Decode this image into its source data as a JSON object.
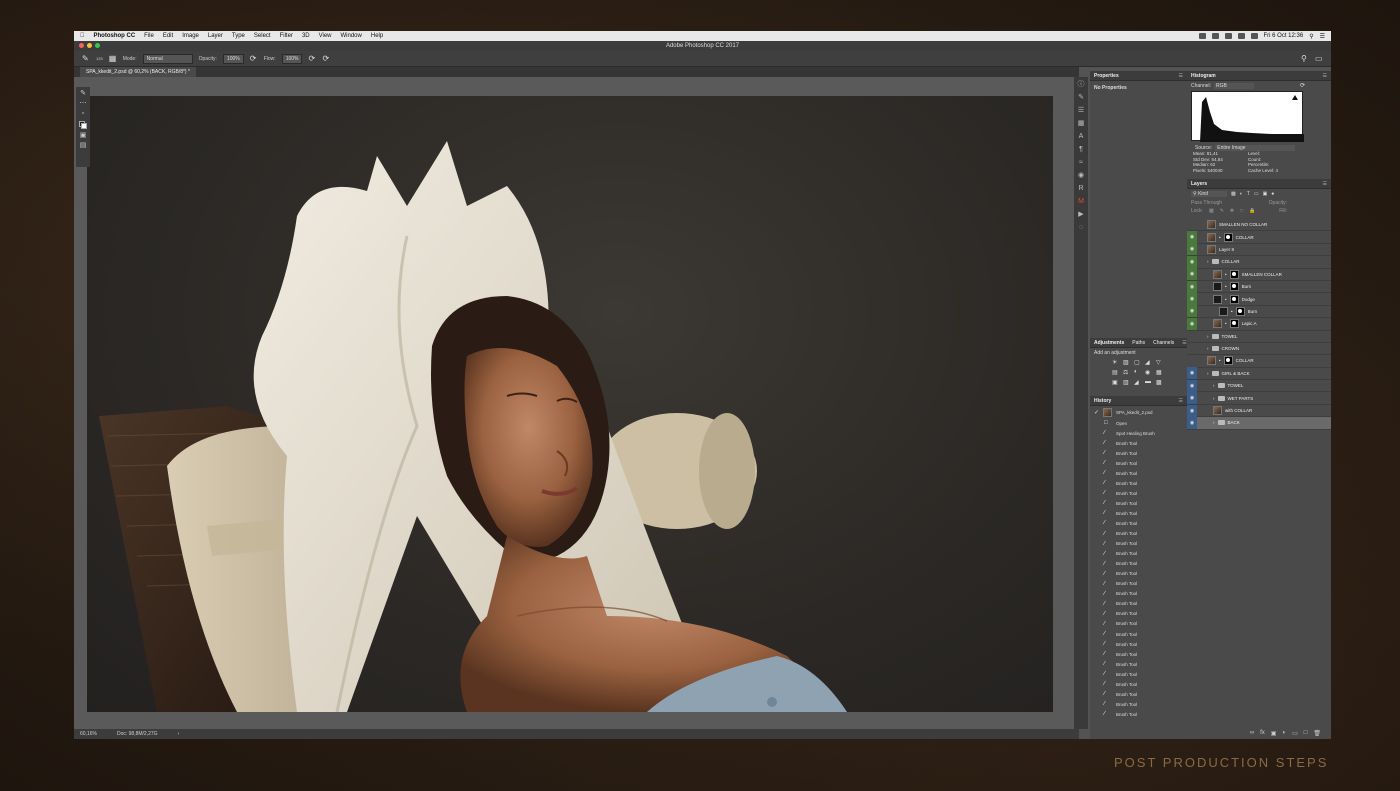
{
  "menubar": {
    "apple": "",
    "app_name": "Photoshop CC",
    "items": [
      "File",
      "Edit",
      "Image",
      "Layer",
      "Type",
      "Select",
      "Filter",
      "3D",
      "View",
      "Window",
      "Help"
    ],
    "clock": "Fri 6 Oct  12:36"
  },
  "window": {
    "title": "Adobe Photoshop CC 2017"
  },
  "options": {
    "brush_size": "125",
    "mode_label": "Mode:",
    "mode_value": "Normal",
    "opacity_label": "Opacity:",
    "opacity_value": "100%",
    "flow_label": "Flow:",
    "flow_value": "100%"
  },
  "document": {
    "tab_label": "SPA_kkedit_2.psd @ 60,2% (BACK, RGB/8*) *",
    "zoom": "60,16%",
    "doc_size": "Doc: 98,8M/2,27G"
  },
  "properties": {
    "title": "Properties",
    "empty": "No Properties"
  },
  "histogram": {
    "title": "Histogram",
    "channel_label": "Channel:",
    "channel_value": "RGB",
    "source_label": "Source:",
    "source_value": "Entire Image",
    "stats": [
      {
        "label": "Mean:",
        "value": "81,41"
      },
      {
        "label": "Level:",
        "value": ""
      },
      {
        "label": "Std Dev:",
        "value": "54,84"
      },
      {
        "label": "Count:",
        "value": ""
      },
      {
        "label": "Median:",
        "value": "62"
      },
      {
        "label": "Percentile:",
        "value": ""
      },
      {
        "label": "Pixels:",
        "value": "540040"
      },
      {
        "label": "Cache Level:",
        "value": "4"
      }
    ]
  },
  "adjustments": {
    "tabs": [
      "Adjustments",
      "Paths",
      "Channels"
    ],
    "hint": "Add an adjustment"
  },
  "history": {
    "title": "History",
    "snapshot": "SPA_kkedit_2.psd",
    "items": [
      "Open",
      "Spot Healing Brush",
      "Brush Tool",
      "Brush Tool",
      "Brush Tool",
      "Brush Tool",
      "Brush Tool",
      "Brush Tool",
      "Brush Tool",
      "Brush Tool",
      "Brush Tool",
      "Brush Tool",
      "Brush Tool",
      "Brush Tool",
      "Brush Tool",
      "Brush Tool",
      "Brush Tool",
      "Brush Tool",
      "Brush Tool",
      "Brush Tool",
      "Brush Tool",
      "Brush Tool",
      "Brush Tool",
      "Brush Tool",
      "Brush Tool",
      "Brush Tool",
      "Brush Tool",
      "Brush Tool",
      "Brush Tool",
      "Brush Tool"
    ]
  },
  "layers": {
    "title": "Layers",
    "filter_value": "Kind",
    "blend_value": "Pass Through",
    "opacity_label": "Opacity:",
    "lock_label": "Lock:",
    "fill_label": "Fill:",
    "rows": [
      {
        "name": "SMALLEN NO COLLAR",
        "indent": 0,
        "eye": "none",
        "kind": "photo"
      },
      {
        "name": "COLLAR",
        "indent": 0,
        "eye": "green",
        "kind": "photo-mask"
      },
      {
        "name": "Layer 8",
        "indent": 0,
        "eye": "green",
        "kind": "photo"
      },
      {
        "name": "COLLAR",
        "indent": 0,
        "eye": "green",
        "kind": "folder"
      },
      {
        "name": "SMALLEN  COLLAR",
        "indent": 1,
        "eye": "green",
        "kind": "photo-mask"
      },
      {
        "name": "Burn",
        "indent": 1,
        "eye": "green",
        "kind": "adj"
      },
      {
        "name": "Dodge",
        "indent": 1,
        "eye": "green",
        "kind": "adj"
      },
      {
        "name": "Burn",
        "indent": 2,
        "eye": "green",
        "kind": "adj"
      },
      {
        "name": "Lapic.A",
        "indent": 1,
        "eye": "green",
        "kind": "photo-mask"
      },
      {
        "name": "TOWEL",
        "indent": 0,
        "eye": "none",
        "kind": "folder"
      },
      {
        "name": "CROWN",
        "indent": 0,
        "eye": "none",
        "kind": "folder"
      },
      {
        "name": "COLLAR",
        "indent": 0,
        "eye": "none",
        "kind": "photo-mask"
      },
      {
        "name": "GIRL & BACK",
        "indent": 0,
        "eye": "blue",
        "kind": "folder"
      },
      {
        "name": "TOWEL",
        "indent": 1,
        "eye": "blue",
        "kind": "folder"
      },
      {
        "name": "WET PARTS",
        "indent": 1,
        "eye": "blue",
        "kind": "folder"
      },
      {
        "name": "with COLLAR",
        "indent": 1,
        "eye": "blue",
        "kind": "photo"
      },
      {
        "name": "BACK",
        "indent": 1,
        "eye": "blue",
        "kind": "folder",
        "selected": true
      }
    ]
  },
  "caption": "POST PRODUCTION STEPS",
  "colors": {
    "green_tag": "#4a7a3b",
    "blue_tag": "#3a5d8a",
    "caption": "#8a6a45"
  }
}
